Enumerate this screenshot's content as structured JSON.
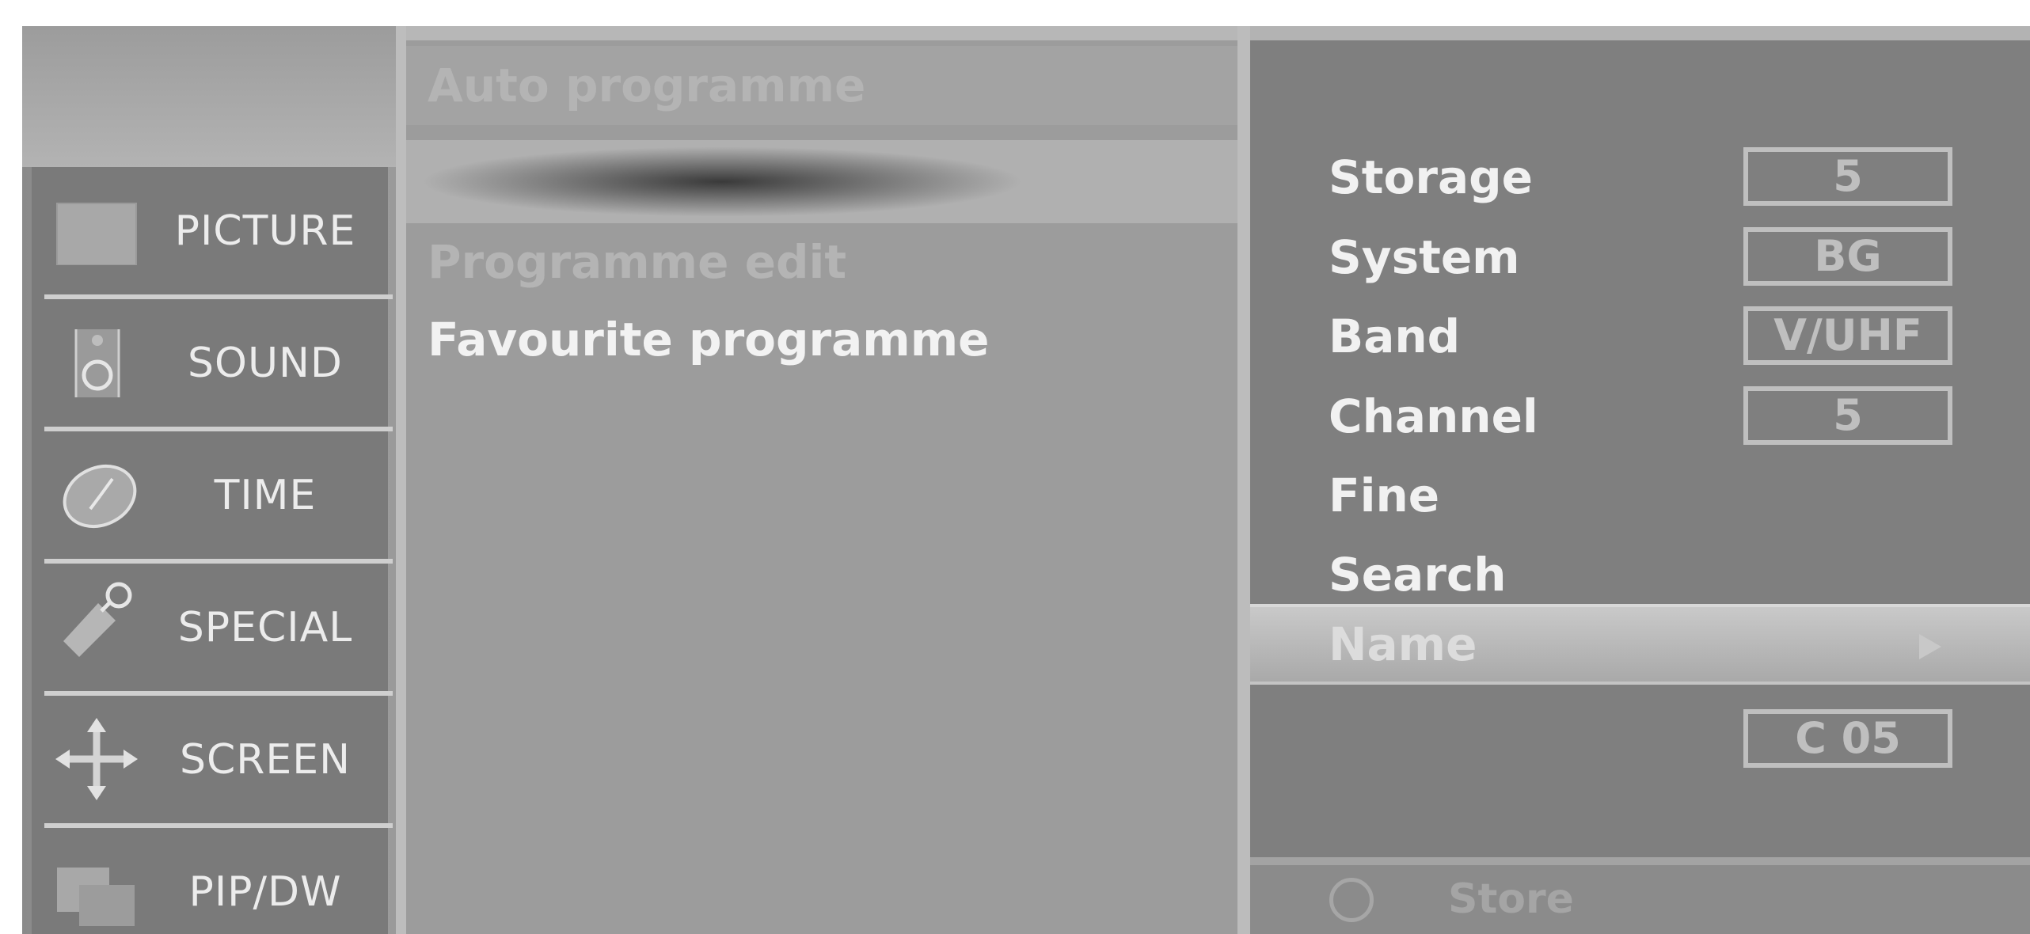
{
  "sidebar": {
    "items": [
      {
        "label": "PICTURE",
        "icon": "picture-icon"
      },
      {
        "label": "SOUND",
        "icon": "speaker-icon"
      },
      {
        "label": "TIME",
        "icon": "clock-icon"
      },
      {
        "label": "SPECIAL",
        "icon": "tag-icon"
      },
      {
        "label": "SCREEN",
        "icon": "move-arrows-icon"
      },
      {
        "label": "PIP/DW",
        "icon": "pip-icon"
      }
    ]
  },
  "middle": {
    "items": [
      {
        "label": "Auto programme",
        "state": "dim"
      },
      {
        "label": "",
        "state": "selected"
      },
      {
        "label": "Programme edit",
        "state": "dim"
      },
      {
        "label": "Favourite programme",
        "state": "bright"
      }
    ]
  },
  "right": {
    "rows": [
      {
        "label": "Storage",
        "value": "5"
      },
      {
        "label": "System",
        "value": "BG"
      },
      {
        "label": "Band",
        "value": "V/UHF"
      },
      {
        "label": "Channel",
        "value": "5"
      },
      {
        "label": "Fine",
        "value": ""
      },
      {
        "label": "Search",
        "value": ""
      }
    ],
    "name_row": {
      "label": "Name",
      "icon": "arrow-right-icon"
    },
    "name_value": "C 05",
    "store": {
      "label": "Store",
      "icon": "ok-button-icon"
    }
  }
}
